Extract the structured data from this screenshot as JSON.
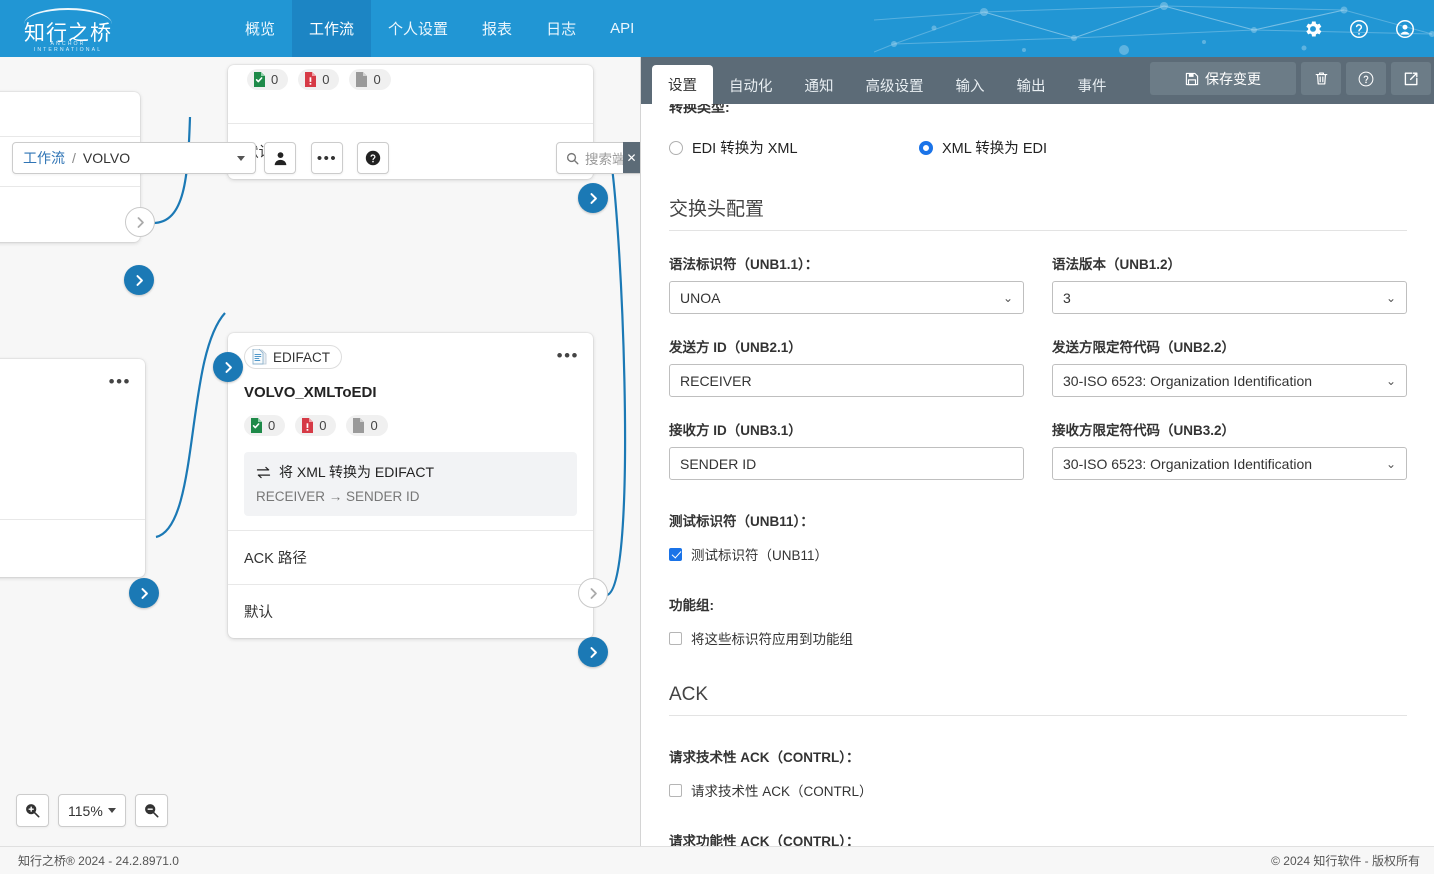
{
  "header": {
    "logo_cn": "知行之桥",
    "logo_en": "ANCHOR INTERNATIONAL",
    "brand_color": "#2196d4",
    "nav": [
      {
        "label": "概览",
        "active": false
      },
      {
        "label": "工作流",
        "active": true
      },
      {
        "label": "个人设置",
        "active": false
      },
      {
        "label": "报表",
        "active": false
      },
      {
        "label": "日志",
        "active": false
      },
      {
        "label": "API",
        "active": false
      }
    ],
    "icons": [
      "gear-icon",
      "help-icon",
      "account-icon"
    ]
  },
  "canvas": {
    "workflow_selector": {
      "link": "工作流",
      "separator": "/",
      "value": "VOLVO"
    },
    "search": {
      "placeholder": "搜索端口、"
    },
    "toolbar": [
      {
        "name": "user-button",
        "icon": "user-icon"
      },
      {
        "name": "more-button",
        "icon": "ellipsis-icon"
      },
      {
        "name": "help-button",
        "icon": "help-icon"
      }
    ],
    "toolbar_counts": [
      {
        "value": "0",
        "state": "success"
      },
      {
        "value": "0",
        "state": "error"
      },
      {
        "value": "0",
        "state": "neutral"
      }
    ],
    "top_node": {
      "rows": [
        {
          "label": "默认"
        }
      ]
    },
    "left_node": {
      "rows": []
    },
    "selected_node": {
      "type_badge": "EDIFACT",
      "title": "VOLVO_XMLToEDI",
      "counts": [
        {
          "value": "0",
          "state": "success"
        },
        {
          "value": "0",
          "state": "error"
        },
        {
          "value": "0",
          "state": "neutral"
        }
      ],
      "operation": {
        "line1": "将 XML 转换为 EDIFACT",
        "line2": "RECEIVER → SENDER ID"
      },
      "rows": [
        {
          "label": "ACK 路径"
        },
        {
          "label": "默认"
        }
      ]
    },
    "zoom": {
      "level": "115%",
      "zoom_in": "zoom-in-icon",
      "zoom_out": "zoom-out-icon"
    }
  },
  "panel": {
    "tabs": [
      {
        "label": "设置",
        "active": true
      },
      {
        "label": "自动化",
        "active": false
      },
      {
        "label": "通知",
        "active": false
      },
      {
        "label": "高级设置",
        "active": false
      },
      {
        "label": "输入",
        "active": false
      },
      {
        "label": "输出",
        "active": false
      },
      {
        "label": "事件",
        "active": false
      }
    ],
    "actions": {
      "save": "保存变更",
      "delete_icon": "trash-icon",
      "help_icon": "help-icon",
      "open_icon": "external-link-icon"
    },
    "conversion": {
      "label": "转换类型:",
      "options": [
        {
          "label": "EDI 转换为 XML",
          "selected": false
        },
        {
          "label": "XML 转换为 EDI",
          "selected": true
        }
      ]
    },
    "interchange": {
      "section_title": "交换头配置",
      "fields": [
        {
          "label": "语法标识符（UNB1.1）：",
          "value": "UNOA",
          "type": "select"
        },
        {
          "label": "语法版本（UNB1.2）",
          "value": "3",
          "type": "select"
        },
        {
          "label": "发送方 ID（UNB2.1）",
          "value": "RECEIVER",
          "type": "input"
        },
        {
          "label": "发送方限定符代码（UNB2.2）",
          "value": "30-ISO 6523: Organization Identification",
          "type": "select"
        },
        {
          "label": "接收方 ID（UNB3.1）",
          "value": "SENDER ID",
          "type": "input"
        },
        {
          "label": "接收方限定符代码（UNB3.2）",
          "value": "30-ISO 6523: Organization Identification",
          "type": "select"
        }
      ],
      "test_indicator_label": "测试标识符（UNB11）：",
      "test_indicator_checkbox": "测试标识符（UNB11）",
      "test_indicator_checked": true,
      "functional_group_label": "功能组:",
      "functional_group_checkbox": "将这些标识符应用到功能组",
      "functional_group_checked": false
    },
    "ack": {
      "section_title": "ACK",
      "technical_label": "请求技术性 ACK（CONTRL）：",
      "technical_checkbox": "请求技术性 ACK（CONTRL）",
      "technical_checked": false,
      "functional_label": "请求功能性 ACK（CONTRL）："
    }
  },
  "footer": {
    "left": "知行之桥® 2024 - 24.2.8971.0",
    "right": "© 2024 知行软件 - 版权所有"
  }
}
